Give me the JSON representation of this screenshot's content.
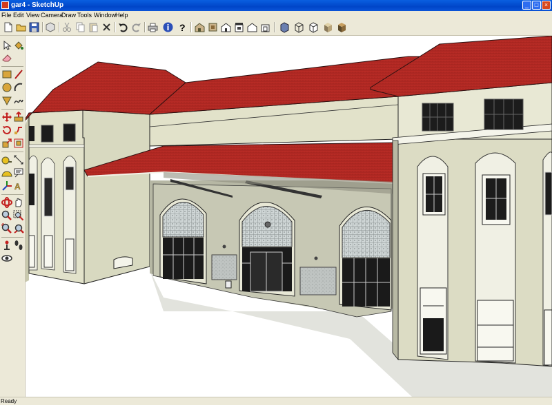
{
  "window": {
    "title": "gar4 - SketchUp",
    "minimize_glyph": "_",
    "maximize_glyph": "□",
    "close_glyph": "×"
  },
  "menu": {
    "items": [
      "File",
      "Edit",
      "View",
      "Camera",
      "Draw",
      "Tools",
      "Window",
      "Help"
    ]
  },
  "toolbar": {
    "icons": [
      "new-icon",
      "open-icon",
      "save-icon",
      "make-component-icon",
      "cut-icon",
      "copy-icon",
      "paste-icon",
      "erase-icon",
      "undo-icon",
      "redo-icon",
      "print-icon",
      "model-info-icon",
      "help-icon",
      "iso-view-icon",
      "top-view-icon",
      "front-view-icon",
      "right-view-icon",
      "back-view-icon",
      "left-view-icon",
      "xray-icon",
      "wireframe-icon",
      "hidden-line-icon",
      "shaded-icon",
      "shaded-textures-icon"
    ]
  },
  "left_toolbar": {
    "icons": [
      "select-icon",
      "paint-bucket-icon",
      "eraser-icon",
      "rectangle-icon",
      "line-icon",
      "circle-icon",
      "arc-icon",
      "polygon-icon",
      "freehand-icon",
      "move-icon",
      "push-pull-icon",
      "rotate-icon",
      "follow-me-icon",
      "scale-icon",
      "offset-icon",
      "tape-measure-icon",
      "dimension-icon",
      "protractor-icon",
      "text-icon",
      "axes-icon",
      "3d-text-icon",
      "orbit-icon",
      "pan-icon",
      "zoom-icon",
      "zoom-window-icon",
      "zoom-extents-icon",
      "previous-view-icon",
      "position-camera-icon",
      "walk-icon",
      "look-around-icon"
    ]
  },
  "colors": {
    "title_bar": "#0a5fe0",
    "chrome": "#ece9d8",
    "roof": "#b52a24",
    "wall": "#dcdcc4",
    "shadow": "#9ba08c"
  },
  "status": {
    "text": "Ready"
  }
}
